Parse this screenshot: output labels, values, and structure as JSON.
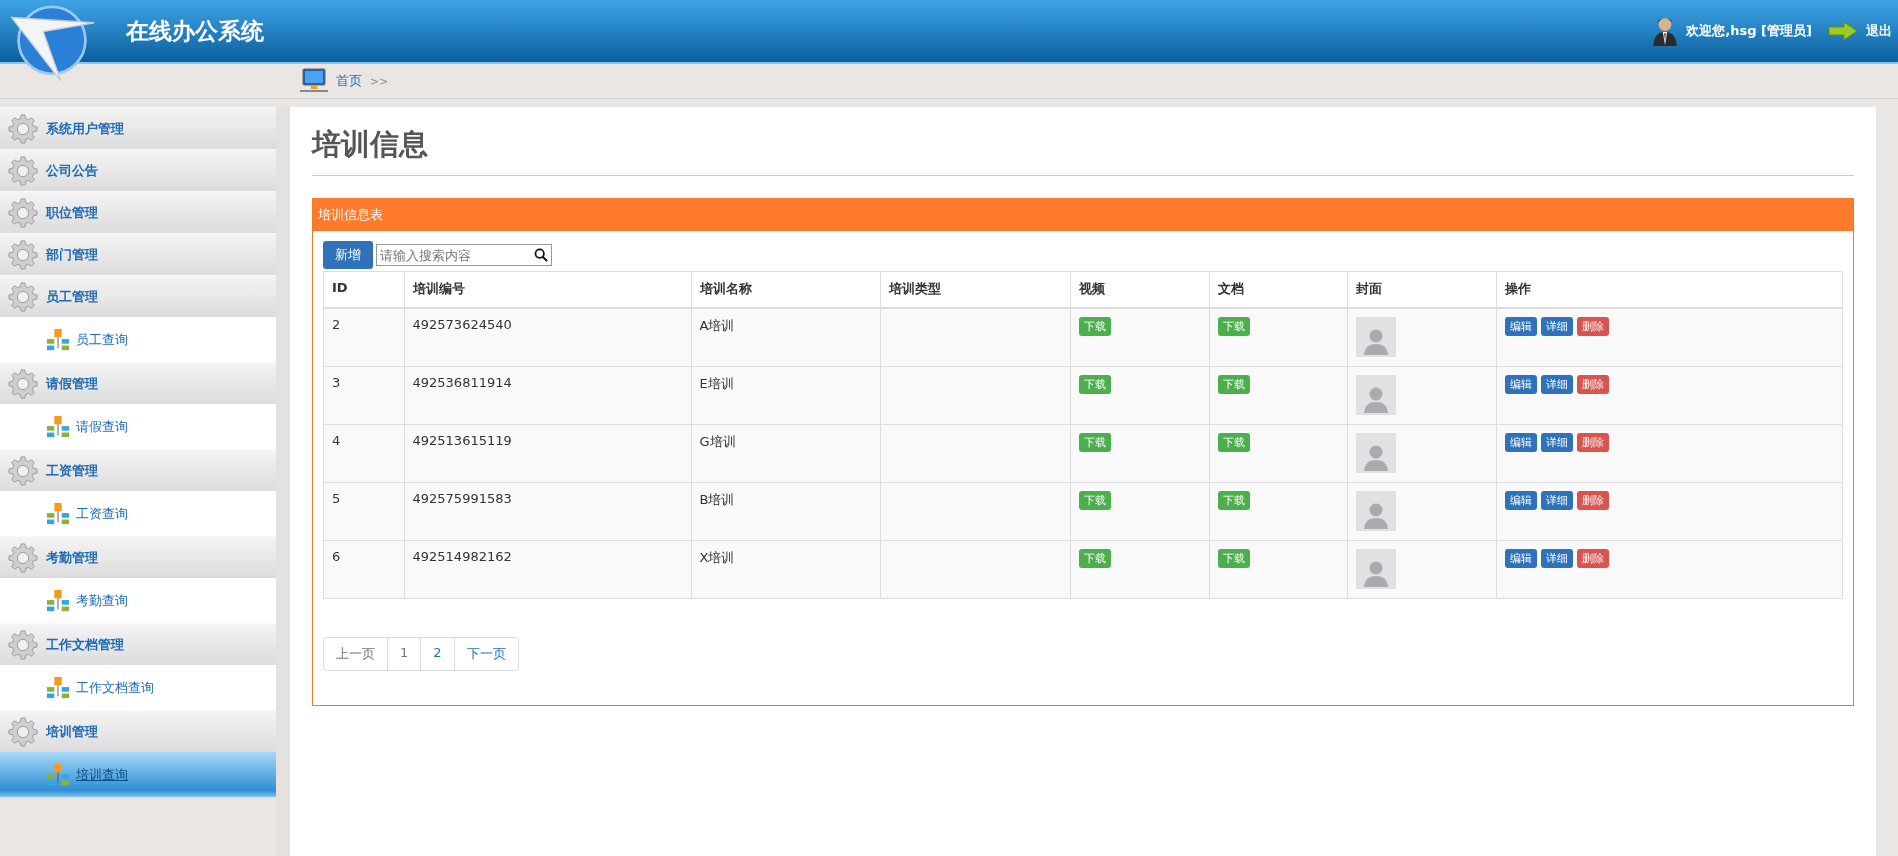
{
  "header": {
    "title": "在线办公系统",
    "user": "欢迎您,hsg [管理员]",
    "logout": "退出"
  },
  "breadcrumb": {
    "home": "首页",
    "separator": ">>"
  },
  "sidebar": {
    "groups": [
      {
        "label": "系统用户管理"
      },
      {
        "label": "公司公告"
      },
      {
        "label": "职位管理"
      },
      {
        "label": "部门管理"
      },
      {
        "label": "员工管理",
        "children": [
          {
            "label": "员工查询",
            "selected": false
          }
        ]
      },
      {
        "label": "请假管理",
        "children": [
          {
            "label": "请假查询",
            "selected": false
          }
        ]
      },
      {
        "label": "工资管理",
        "children": [
          {
            "label": "工资查询",
            "selected": false
          }
        ]
      },
      {
        "label": "考勤管理",
        "children": [
          {
            "label": "考勤查询",
            "selected": false
          }
        ]
      },
      {
        "label": "工作文档管理",
        "children": [
          {
            "label": "工作文档查询",
            "selected": false
          }
        ]
      },
      {
        "label": "培训管理",
        "children": [
          {
            "label": "培训查询",
            "selected": true
          }
        ]
      }
    ]
  },
  "page_title": "培训信息",
  "panel": {
    "title": "培训信息表",
    "add_button": "新增",
    "search": {
      "placeholder": "请输入搜索内容"
    },
    "table": {
      "columns": [
        "ID",
        "培训编号",
        "培训名称",
        "培训类型",
        "视频",
        "文档",
        "封面",
        "操作"
      ],
      "rows": [
        {
          "id": "2",
          "code": "492573624540",
          "name": "A培训",
          "video": "下载",
          "doc": "下载",
          "actions": [
            {
              "label": "编辑",
              "kind": "edit"
            },
            {
              "label": "详细",
              "kind": "detail"
            },
            {
              "label": "删除",
              "kind": "delete"
            }
          ]
        },
        {
          "id": "3",
          "code": "492536811914",
          "name": "E培训",
          "video": "下载",
          "doc": "下载",
          "actions": [
            {
              "label": "编辑",
              "kind": "edit"
            },
            {
              "label": "详细",
              "kind": "detail"
            },
            {
              "label": "删除",
              "kind": "delete"
            }
          ]
        },
        {
          "id": "4",
          "code": "492513615119",
          "name": "G培训",
          "video": "下载",
          "doc": "下载",
          "actions": [
            {
              "label": "编辑",
              "kind": "edit"
            },
            {
              "label": "详细",
              "kind": "detail"
            },
            {
              "label": "删除",
              "kind": "delete"
            }
          ]
        },
        {
          "id": "5",
          "code": "492575991583",
          "name": "B培训",
          "video": "下载",
          "doc": "下载",
          "actions": [
            {
              "label": "编辑",
              "kind": "edit"
            },
            {
              "label": "详细",
              "kind": "detail"
            },
            {
              "label": "删除",
              "kind": "delete"
            }
          ]
        },
        {
          "id": "6",
          "code": "492514982162",
          "name": "X培训",
          "video": "下载",
          "doc": "下载",
          "actions": [
            {
              "label": "编辑",
              "kind": "edit"
            },
            {
              "label": "详细",
              "kind": "detail"
            },
            {
              "label": "删除",
              "kind": "delete"
            }
          ]
        }
      ]
    },
    "pagination": {
      "prev": {
        "label": "上一页",
        "disabled": true
      },
      "pages": [
        {
          "label": "1",
          "selected": true
        },
        {
          "label": "2",
          "selected": false
        }
      ],
      "next": {
        "label": "下一页",
        "disabled": false
      }
    }
  }
}
